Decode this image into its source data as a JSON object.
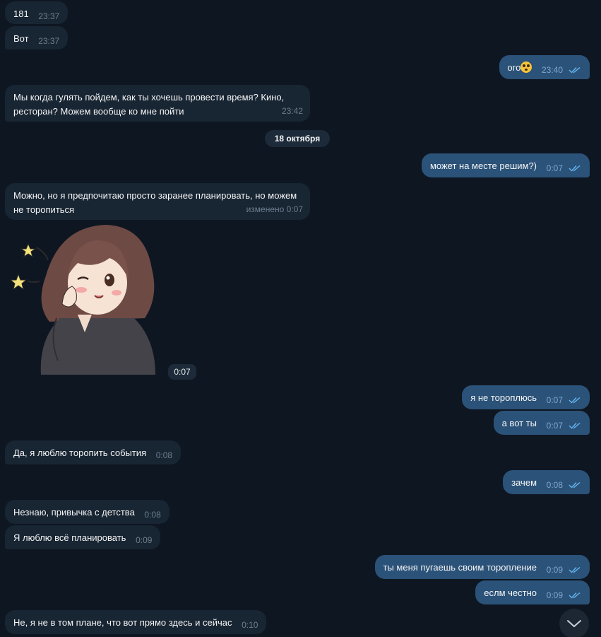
{
  "date_divider": "18 октября",
  "messages": [
    {
      "id": "m1",
      "dir": "in",
      "text": "181",
      "time": "23:37"
    },
    {
      "id": "m2",
      "dir": "in",
      "text": "Вот",
      "time": "23:37"
    },
    {
      "id": "m3",
      "dir": "out",
      "text": "ого",
      "emoji": "flushed-face-emoji",
      "time": "23:40",
      "read": true
    },
    {
      "id": "m4",
      "dir": "in",
      "text": "Мы когда гулять пойдем, как ты хочешь провести время? Кино, ресторан? Можем вообще ко мне пойти",
      "time": "23:42"
    },
    {
      "id": "m5",
      "dir": "out",
      "text": "может на месте решим?)",
      "time": "0:07",
      "read": true
    },
    {
      "id": "m6",
      "dir": "in",
      "text": "Можно, но я предпочитаю просто заранее планировать, но можем не торопиться",
      "time": "изменено 0:07"
    },
    {
      "id": "m7",
      "dir": "in",
      "type": "sticker",
      "sticker": "anime-girl-wink-sticker",
      "time": "0:07"
    },
    {
      "id": "m8",
      "dir": "out",
      "text": "я не тороплюсь",
      "time": "0:07",
      "read": true
    },
    {
      "id": "m9",
      "dir": "out",
      "text": "а вот ты",
      "time": "0:07",
      "read": true
    },
    {
      "id": "m10",
      "dir": "in",
      "text": "Да, я люблю торопить события",
      "time": "0:08"
    },
    {
      "id": "m11",
      "dir": "out",
      "text": "зачем",
      "time": "0:08",
      "read": true
    },
    {
      "id": "m12",
      "dir": "in",
      "text": "Незнаю, привычка с детства",
      "time": "0:08"
    },
    {
      "id": "m13",
      "dir": "in",
      "text": "Я люблю всё планировать",
      "time": "0:09"
    },
    {
      "id": "m14",
      "dir": "out",
      "text": "ты меня пугаешь своим торопление",
      "time": "0:09",
      "read": true
    },
    {
      "id": "m15",
      "dir": "out",
      "text": "еслм честно",
      "time": "0:09",
      "read": true
    },
    {
      "id": "m16",
      "dir": "in",
      "text": "Не, я не в том плане, что вот прямо здесь и сейчас",
      "time": "0:10"
    }
  ],
  "colors": {
    "background": "#0e1621",
    "incoming_bubble": "#182533",
    "outgoing_bubble": "#2b5278",
    "read_check": "#64b5ef"
  },
  "scroll_button_icon": "chevron-down-icon"
}
